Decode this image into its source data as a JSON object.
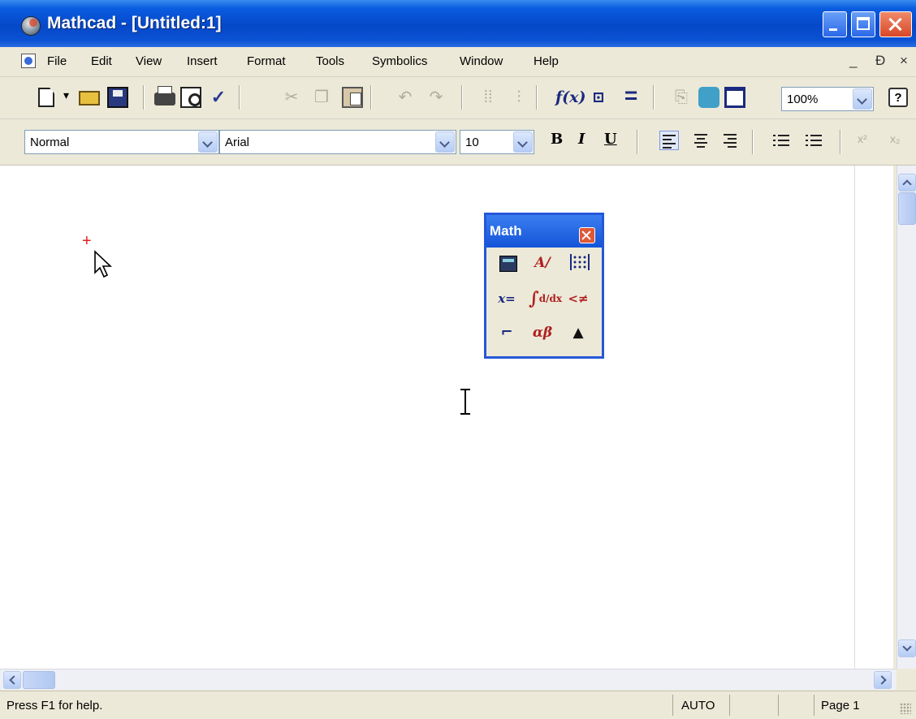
{
  "window": {
    "title": "Mathcad - [Untitled:1]"
  },
  "menu": {
    "items": [
      "File",
      "Edit",
      "View",
      "Insert",
      "Format",
      "Tools",
      "Symbolics",
      "Window",
      "Help"
    ],
    "mdi_controls": [
      "_",
      "Ɖ",
      "×"
    ]
  },
  "toolbar_standard": {
    "zoom_value": "100%",
    "help_label": "?",
    "buttons": [
      "new-document",
      "open-folder",
      "save-disk",
      "print",
      "print-preview",
      "spell-check",
      "cut",
      "copy",
      "paste",
      "undo",
      "redo",
      "align-across",
      "align-down",
      "insert-function",
      "insert-unit",
      "calculate",
      "component",
      "resource-center",
      "window"
    ]
  },
  "toolbar_formatting": {
    "style": "Normal",
    "font": "Arial",
    "size": "10",
    "bold": "B",
    "italic": "I",
    "underline": "U",
    "superscript": "x²",
    "subscript": "x₂"
  },
  "math_palette": {
    "title": "Math",
    "buttons": [
      {
        "name": "calculator-toolbar-icon",
        "glyph": ""
      },
      {
        "name": "graph-toolbar-icon",
        "glyph": "❀"
      },
      {
        "name": "matrix-toolbar-icon",
        "glyph": ""
      },
      {
        "name": "evaluation-toolbar-icon",
        "glyph": "x="
      },
      {
        "name": "calculus-toolbar-icon",
        "glyph": "∫"
      },
      {
        "name": "boolean-toolbar-icon",
        "glyph": "<≤"
      },
      {
        "name": "programming-toolbar-icon",
        "glyph": "☐"
      },
      {
        "name": "greek-toolbar-icon",
        "glyph": "αβ"
      },
      {
        "name": "symbolic-toolbar-icon",
        "glyph": "🎓"
      }
    ]
  },
  "status": {
    "help_text": "Press F1 for help.",
    "mode": "AUTO",
    "page": "Page 1"
  }
}
